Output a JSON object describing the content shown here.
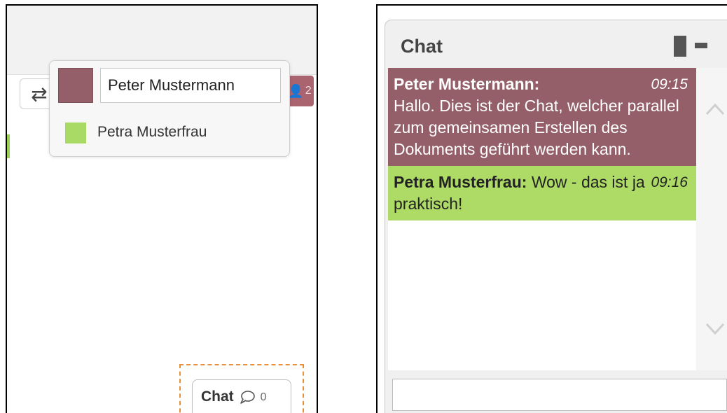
{
  "left": {
    "sync_icon": "swap-arrows-icon",
    "users_button": {
      "icon": "users-icon",
      "count": "2",
      "color": "#a9646f"
    },
    "user_popup": {
      "own_user": {
        "name": "Peter Mustermann",
        "color": "#955f6a"
      },
      "other_users": [
        {
          "name": "Petra Musterfrau",
          "color": "#a9da65"
        }
      ]
    },
    "chat_button": {
      "label": "Chat",
      "icon": "speech-bubble-icon",
      "count": "0"
    },
    "highlight_color": "#e8913a"
  },
  "chat": {
    "title": "Chat",
    "controls": [
      "stick-icon",
      "minimize-icon"
    ],
    "messages": [
      {
        "author": "Peter Mustermann:",
        "time": "09:15",
        "text": "Hallo. Dies ist der Chat, welcher parallel zum gemeinsamen Erstellen des Dokuments geführt werden kann.",
        "color": "#955f6a"
      },
      {
        "author": "Petra Musterfrau:",
        "time": "09:16",
        "text": "Wow - das ist ja praktisch!",
        "color": "#aedb66"
      }
    ],
    "input_value": ""
  }
}
